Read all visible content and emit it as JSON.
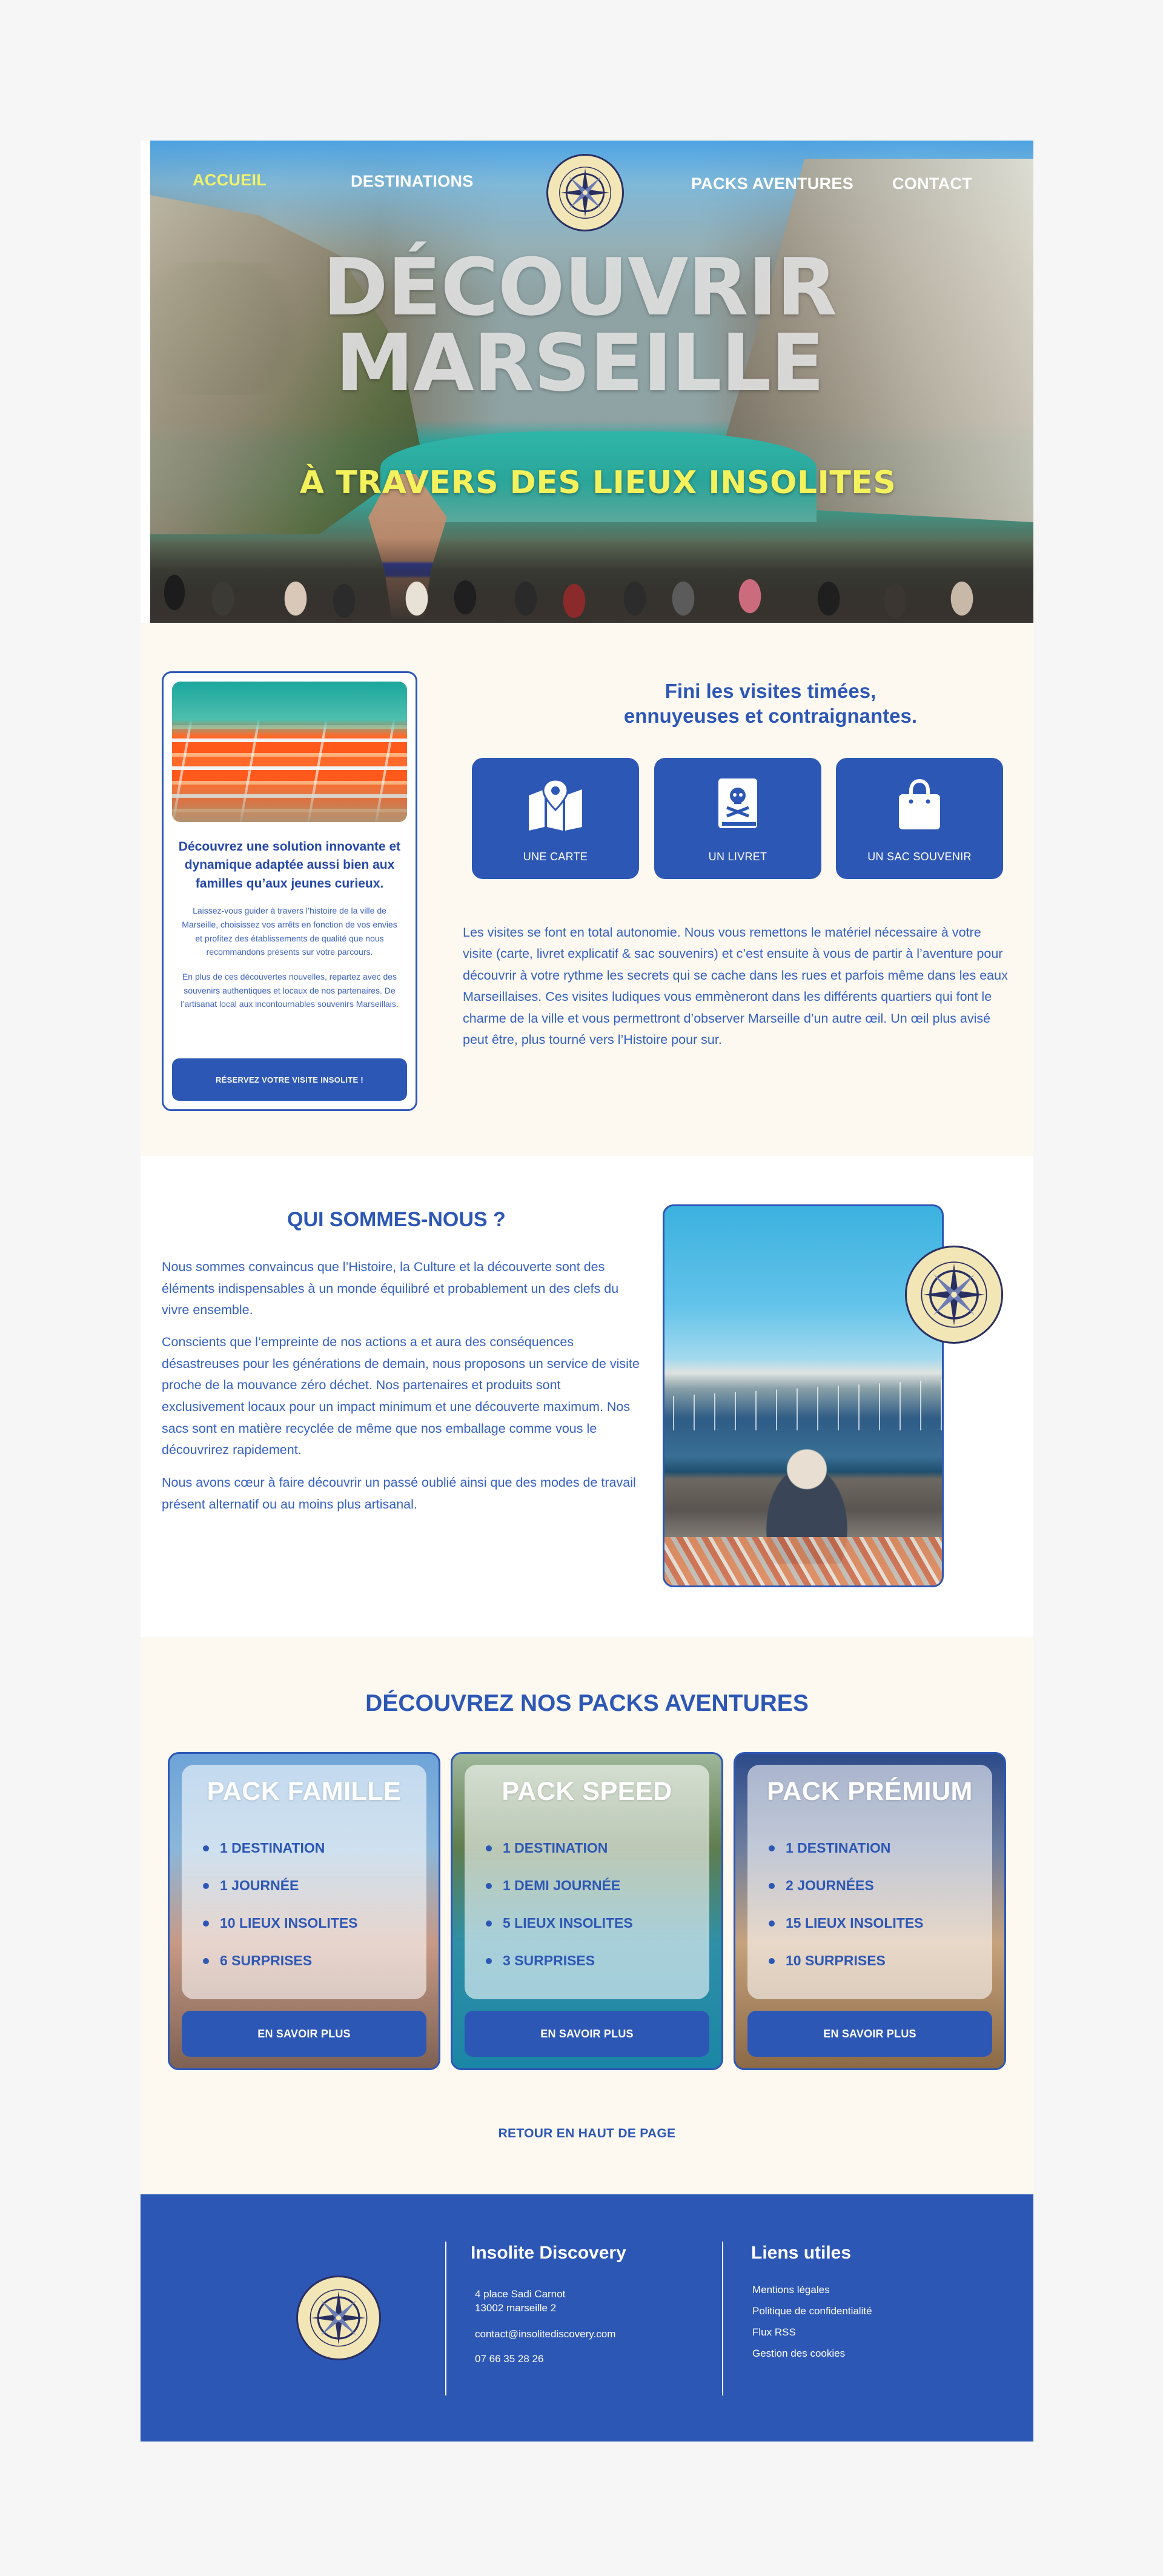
{
  "nav": {
    "items": [
      {
        "label": "ACCUEIL",
        "active": true
      },
      {
        "label": "DESTINATIONS"
      },
      {
        "label": "PACKS AVENTURES"
      },
      {
        "label": "CONTACT"
      }
    ]
  },
  "hero": {
    "title_line1": "DÉCOUVRIR",
    "title_line2": "MARSEILLE",
    "subtitle": "À TRAVERS DES LIEUX INSOLITES"
  },
  "logo": {
    "icon": "compass-rose-icon",
    "text": "Insolite Discovery"
  },
  "promo": {
    "title": "Découvrez une solution innovante et dynamique adaptée aussi bien aux familles qu’aux jeunes curieux.",
    "text1": "Laissez-vous guider à travers l’histoire de la ville de Marseille, choisissez vos arrêts en fonction de vos envies et profitez des établissements de qualité que nous recommandons présents sur votre parcours.",
    "text2": "En plus de ces découvertes nouvelles, repartez avec des souvenirs authentiques et locaux de nos partenaires. De l’artisanat local aux incontournables souvenirs Marseillais.",
    "button": "RÉSERVEZ VOTRE VISITE INSOLITE !"
  },
  "intro": {
    "heading_line1": "Fini les visites timées,",
    "heading_line2": "ennuyeuses et contraignantes.",
    "features": [
      {
        "label": "UNE CARTE",
        "icon": "map-pin-icon"
      },
      {
        "label": "UN LIVRET",
        "icon": "booklet-skull-icon"
      },
      {
        "label": "UN SAC SOUVENIR",
        "icon": "shopping-bag-icon"
      }
    ],
    "paragraph": "Les visites se font en total autonomie. Nous vous remettons le matériel nécessaire à votre visite (carte, livret explicatif & sac souvenirs) et c’est ensuite à vous de partir à l’aventure pour découvrir à votre rythme les secrets qui se cache dans les rues et parfois même dans les eaux Marseillaises. Ces visites ludiques vous emmèneront dans les différents quartiers qui font le charme de la ville et vous permettront d’observer Marseille d’un autre œil. Un œil plus avisé peut être, plus tourné vers l’Histoire pour sur."
  },
  "about": {
    "title": "QUI SOMMES-NOUS ?",
    "p1": "Nous sommes convaincus que l’Histoire, la Culture et la découverte sont des éléments indispensables à un monde équilibré et probablement un des clefs du vivre ensemble.",
    "p2": "Conscients que l’empreinte de nos actions a et aura des conséquences désastreuses pour les générations de demain, nous proposons un service de visite proche de la mouvance zéro déchet. Nos partenaires et produits sont exclusivement locaux pour un impact minimum et une découverte maximum. Nos sacs sont en matière recyclée de même que nos emballage comme vous le découvrirez rapidement.",
    "p3": "Nous avons cœur à faire découvrir un passé oublié ainsi que des modes de travail présent alternatif ou au moins plus artisanal."
  },
  "packs": {
    "title": "DÉCOUVREZ NOS PACKS AVENTURES",
    "items": [
      {
        "name": "PACK FAMILLE",
        "features": [
          "1 DESTINATION",
          "1 JOURNÉE",
          "10 LIEUX INSOLITES",
          "6 SURPRISES"
        ],
        "button": "EN SAVOIR PLUS"
      },
      {
        "name": "PACK SPEED",
        "features": [
          "1 DESTINATION",
          "1 DEMI JOURNÉE",
          "5 LIEUX INSOLITES",
          "3 SURPRISES"
        ],
        "button": "EN SAVOIR PLUS"
      },
      {
        "name": "PACK PRÉMIUM",
        "features": [
          "1 DESTINATION",
          "2 JOURNÉES",
          "15 LIEUX INSOLITES",
          "10 SURPRISES"
        ],
        "button": "EN SAVOIR PLUS"
      }
    ],
    "back_to_top": "RETOUR EN HAUT DE PAGE"
  },
  "footer": {
    "brand": "Insolite Discovery",
    "address_line1": "4 place Sadi Carnot",
    "address_line2": "13002 marseille 2",
    "email": "contact@insolitediscovery.com",
    "phone": "07 66 35 28 26",
    "links_title": "Liens utiles",
    "links": [
      "Mentions légales",
      "Politique de confidentialité",
      "Flux RSS",
      "Gestion des cookies"
    ]
  },
  "colors": {
    "primary_blue": "#2d57b5",
    "accent_yellow": "#f3f15c",
    "cream": "#fdf9f1",
    "logo_gold": "#f3e6b6",
    "logo_navy": "#2a2f61"
  }
}
